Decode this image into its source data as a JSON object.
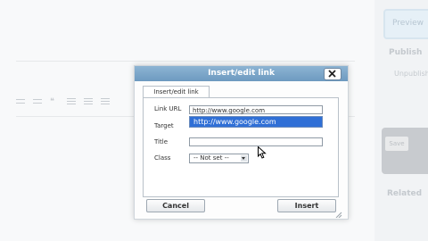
{
  "background": {
    "toolbar_icons": [
      "bullet-list-icon",
      "numbered-list-icon",
      "blockquote-icon",
      "align-left-icon",
      "align-center-icon",
      "align-right-icon"
    ],
    "sidebar": {
      "preview_label": "Preview",
      "publish_label": "Publish",
      "unpublished_label": "Unpublish",
      "save_label": "Save",
      "related_label": "Related"
    }
  },
  "dialog": {
    "title": "Insert/edit link",
    "tab_label": "Insert/edit link",
    "fields": {
      "link_url_label": "Link URL",
      "link_url_value": "http://www.google.com",
      "target_label": "Target",
      "title_label": "Title",
      "title_value": "",
      "class_label": "Class",
      "class_value": "-- Not set --"
    },
    "autocomplete_option": "http://www.google.com",
    "cancel_label": "Cancel",
    "insert_label": "Insert"
  },
  "colors": {
    "titlebar": "#7ba7cb",
    "autocomplete_highlight": "#2f6fd6"
  }
}
